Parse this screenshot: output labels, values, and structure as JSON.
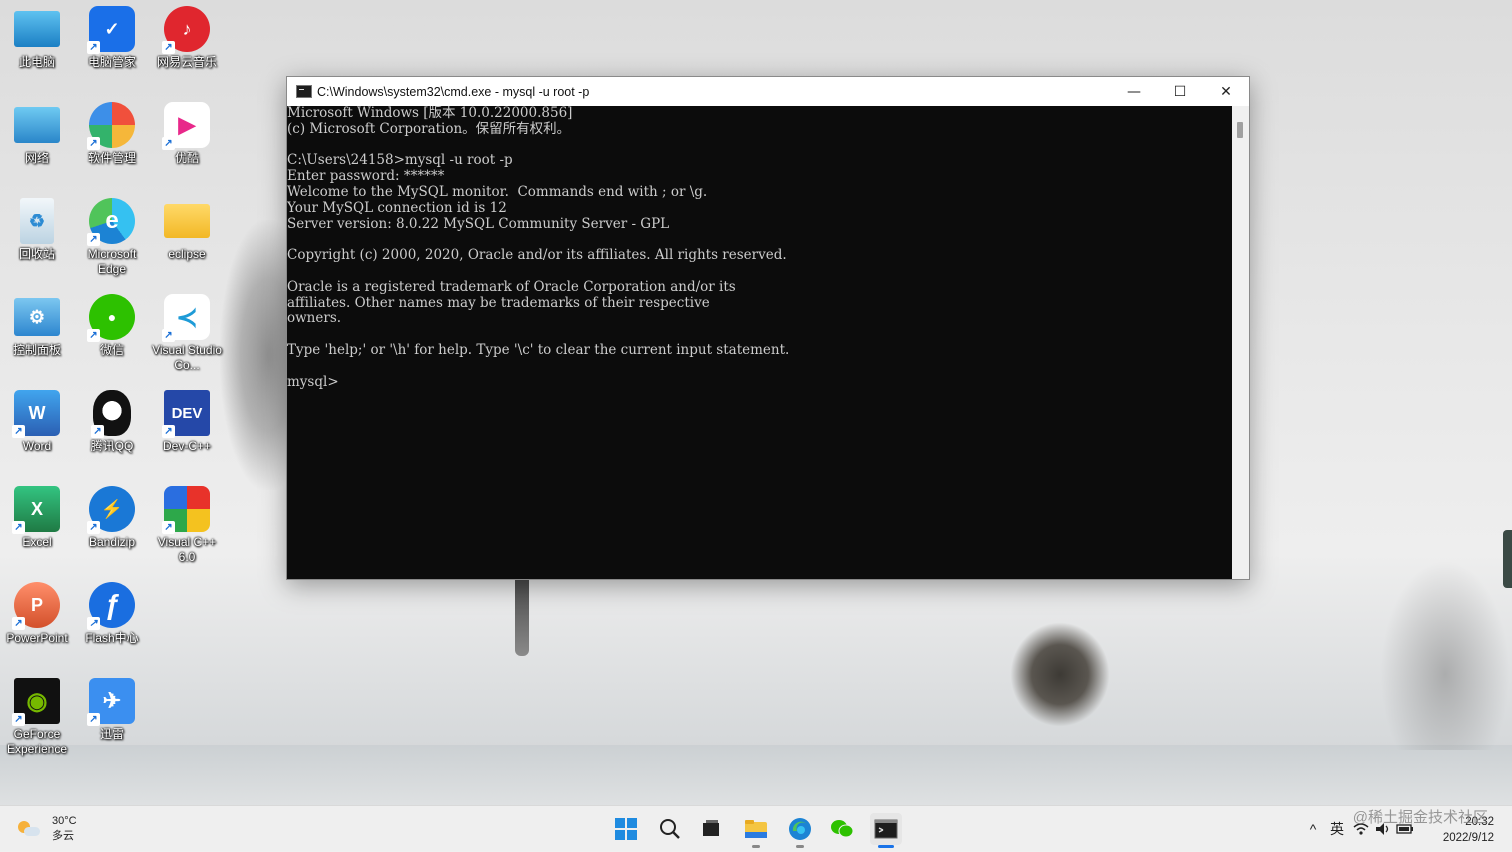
{
  "desktop": {
    "icons": [
      {
        "label": "此电脑",
        "icon": "computer-icon",
        "color": "#2d9bd8"
      },
      {
        "label": "电脑管家",
        "icon": "shield-icon",
        "color": "#1a6fe8"
      },
      {
        "label": "网易云音乐",
        "icon": "music-icon",
        "color": "#e0262e"
      },
      {
        "label": "网络",
        "icon": "network-icon",
        "color": "#3a9ad9"
      },
      {
        "label": "软件管理",
        "icon": "app-store-icon",
        "color": "#e8a03a"
      },
      {
        "label": "优酷",
        "icon": "youku-icon",
        "color": "#1f8bf0"
      },
      {
        "label": "回收站",
        "icon": "recycle-bin-icon",
        "color": "#d8e6ef"
      },
      {
        "label": "Microsoft Edge",
        "icon": "edge-icon",
        "color": "#1ba1c9"
      },
      {
        "label": "eclipse",
        "icon": "folder-icon",
        "color": "#f4c542"
      },
      {
        "label": "控制面板",
        "icon": "control-panel-icon",
        "color": "#3b8fd6"
      },
      {
        "label": "微信",
        "icon": "wechat-icon",
        "color": "#2dc100"
      },
      {
        "label": "Visual Studio Co...",
        "icon": "vscode-icon",
        "color": "#1e9bd7"
      },
      {
        "label": "Word",
        "icon": "word-icon",
        "color": "#2b5fb3"
      },
      {
        "label": "腾讯QQ",
        "icon": "qq-icon",
        "color": "#111111"
      },
      {
        "label": "Dev-C++",
        "icon": "devcpp-icon",
        "color": "#2548a8"
      },
      {
        "label": "Excel",
        "icon": "excel-icon",
        "color": "#1f7a44"
      },
      {
        "label": "Bandizip",
        "icon": "bandizip-icon",
        "color": "#1a78d6"
      },
      {
        "label": "Visual C++ 6.0",
        "icon": "visual-cpp-icon",
        "color": "#d03d2e"
      },
      {
        "label": "PowerPoint",
        "icon": "powerpoint-icon",
        "color": "#d3502b"
      },
      {
        "label": "Flash中心",
        "icon": "flash-icon",
        "color": "#1a6ee0"
      },
      {
        "label": "",
        "icon": "blank-icon",
        "color": "#ffffff"
      },
      {
        "label": "GeForce Experience",
        "icon": "nvidia-icon",
        "color": "#76b900"
      },
      {
        "label": "迅雷",
        "icon": "xunlei-icon",
        "color": "#3b8ff0"
      }
    ],
    "icon_glyphs": {
      "computer": "▭",
      "shield": "✓",
      "music": "♪",
      "network": "▭",
      "apps": "✿",
      "youku": "▶",
      "recycle": "♻",
      "edge": "e",
      "folder": "",
      "panel": "⚙",
      "wechat": "●",
      "vscode": "≺",
      "word": "W",
      "qq": "◕",
      "dev": "DEV",
      "excel": "X",
      "bandizip": "⚡",
      "vcpp": "◈",
      "ppt": "P",
      "flash": "ƒ",
      "nvidia": "◉",
      "xunlei": "✈"
    }
  },
  "cmd_window": {
    "title": "C:\\Windows\\system32\\cmd.exe - mysql  -u root -p",
    "minimize": "—",
    "maximize": "☐",
    "close": "✕",
    "lines": [
      "Microsoft Windows [版本 10.0.22000.856]",
      "(c) Microsoft Corporation。保留所有权利。",
      "",
      "C:\\Users\\24158>mysql -u root -p",
      "Enter password: ******",
      "Welcome to the MySQL monitor.  Commands end with ; or \\g.",
      "Your MySQL connection id is 12",
      "Server version: 8.0.22 MySQL Community Server - GPL",
      "",
      "Copyright (c) 2000, 2020, Oracle and/or its affiliates. All rights reserved.",
      "",
      "Oracle is a registered trademark of Oracle Corporation and/or its",
      "affiliates. Other names may be trademarks of their respective",
      "owners.",
      "",
      "Type 'help;' or '\\h' for help. Type '\\c' to clear the current input statement.",
      "",
      "mysql>"
    ]
  },
  "taskbar": {
    "weather": {
      "temp": "30°C",
      "condition": "多云"
    },
    "apps": [
      {
        "name": "start-button",
        "glyph": "⊞"
      },
      {
        "name": "search-button",
        "glyph": "⌕"
      },
      {
        "name": "task-view-button",
        "glyph": "▣"
      },
      {
        "name": "file-explorer-button",
        "glyph": "▬"
      },
      {
        "name": "edge-button",
        "glyph": "e"
      },
      {
        "name": "wechat-button",
        "glyph": "●"
      },
      {
        "name": "terminal-button",
        "glyph": ">_"
      }
    ],
    "tray": {
      "chevron": "^",
      "ime": "英",
      "wifi": "wifi-icon",
      "volume": "volume-icon",
      "battery": "battery-icon"
    },
    "time": "20:32",
    "date": "2022/9/12",
    "watermark": "@稀土掘金技术社区"
  }
}
